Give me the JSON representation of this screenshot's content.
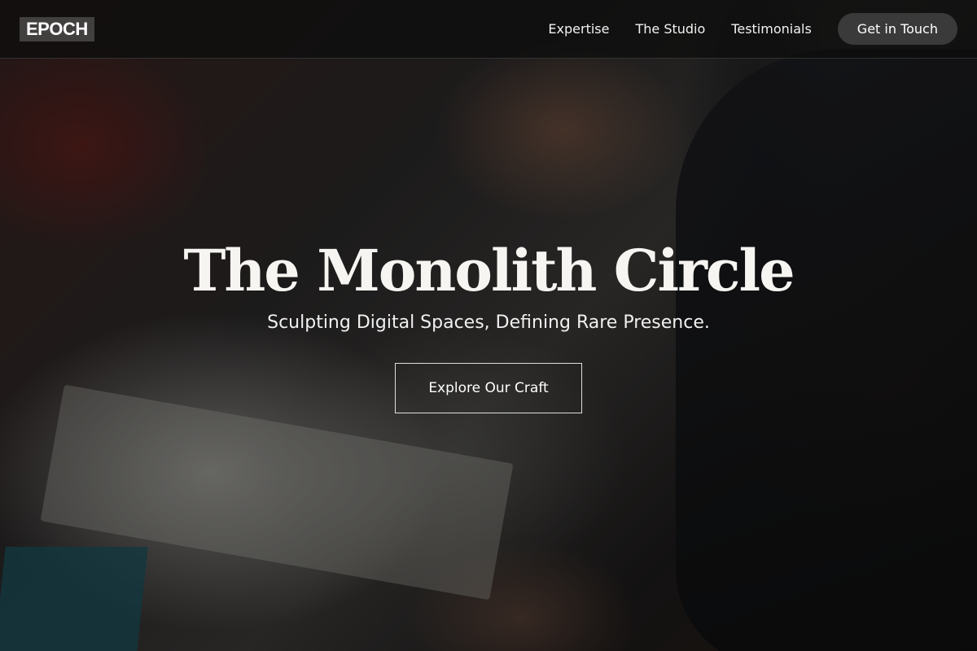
{
  "header": {
    "logo": "EPOCH",
    "nav": [
      {
        "label": "Expertise"
      },
      {
        "label": "The Studio"
      },
      {
        "label": "Testimonials"
      }
    ],
    "cta_label": "Get in Touch"
  },
  "hero": {
    "title": "The Monolith Circle",
    "subtitle": "Sculpting Digital Spaces, Defining Rare Presence.",
    "button_label": "Explore Our Craft",
    "image": "person-drawing-at-desk-photo"
  },
  "colors": {
    "overlay": "#000000",
    "header_bg": "#0c0c0c",
    "cta_bg": "#3a3a3a",
    "text": "#ffffff"
  }
}
